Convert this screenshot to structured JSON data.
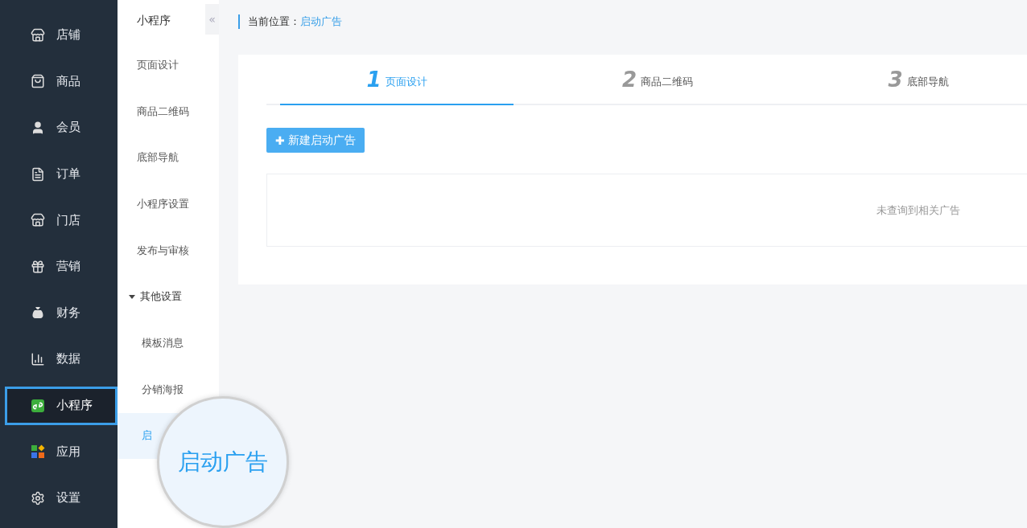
{
  "sidebar": {
    "items": [
      {
        "label": "店铺",
        "selected": false
      },
      {
        "label": "商品",
        "selected": false
      },
      {
        "label": "会员",
        "selected": false
      },
      {
        "label": "订单",
        "selected": false
      },
      {
        "label": "门店",
        "selected": false
      },
      {
        "label": "营销",
        "selected": false
      },
      {
        "label": "财务",
        "selected": false
      },
      {
        "label": "数据",
        "selected": false
      },
      {
        "label": "小程序",
        "selected": true
      },
      {
        "label": "应用",
        "selected": false
      },
      {
        "label": "设置",
        "selected": false
      }
    ]
  },
  "submenu": {
    "title": "小程序",
    "collapse": "«",
    "items": [
      {
        "label": "页面设计",
        "kind": "link",
        "selected": false
      },
      {
        "label": "商品二维码",
        "kind": "link",
        "selected": false
      },
      {
        "label": "底部导航",
        "kind": "link",
        "selected": false
      },
      {
        "label": "小程序设置",
        "kind": "link",
        "selected": false
      },
      {
        "label": "发布与审核",
        "kind": "link",
        "selected": false
      },
      {
        "label": "其他设置",
        "kind": "group",
        "expanded": true,
        "children": [
          {
            "label": "模板消息",
            "selected": false
          },
          {
            "label": "分销海报",
            "selected": false
          },
          {
            "label": "启",
            "selected": true
          }
        ]
      }
    ]
  },
  "magnifier": {
    "label": "启动广告"
  },
  "breadcrumb": {
    "label": "当前位置：",
    "current": "启动广告"
  },
  "steps": [
    {
      "number": "1",
      "label": "页面设计",
      "selected": true
    },
    {
      "number": "2",
      "label": "商品二维码",
      "selected": false
    },
    {
      "number": "3",
      "label": "底部导航",
      "selected": false
    }
  ],
  "new_button": {
    "icon": "✚",
    "label": "新建启动广告"
  },
  "empty_message": "未查询到相关广告"
}
